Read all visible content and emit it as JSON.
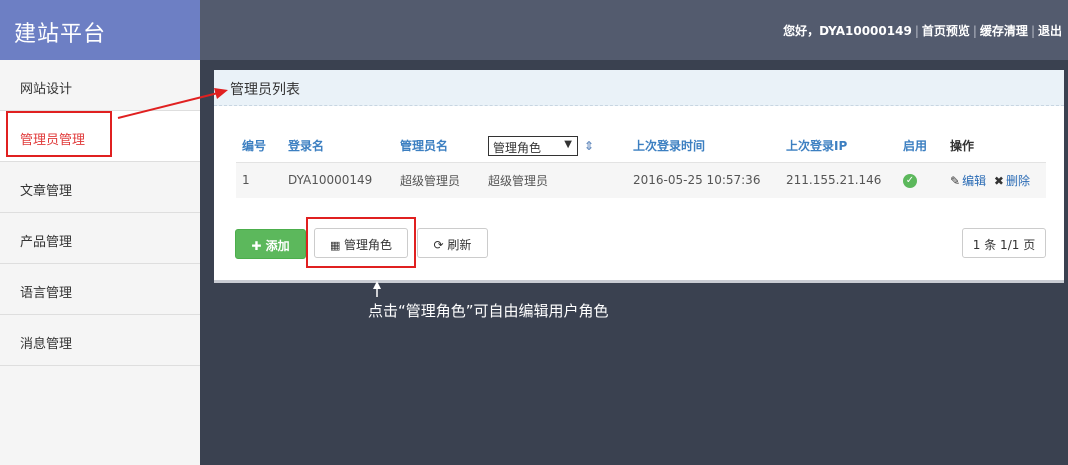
{
  "app": {
    "logo": "建站平台"
  },
  "topnav": {
    "greeting": "您好，",
    "username": "DYA10000149",
    "preview": "首页预览",
    "clear_cache": "缓存清理",
    "logout": "退出"
  },
  "sidebar": {
    "items": [
      {
        "label": "网站设计"
      },
      {
        "label": "管理员管理",
        "active": true
      },
      {
        "label": "文章管理"
      },
      {
        "label": "产品管理"
      },
      {
        "label": "语言管理"
      },
      {
        "label": "消息管理"
      }
    ]
  },
  "panel": {
    "title": "管理员列表",
    "columns": {
      "id": "编号",
      "login": "登录名",
      "admin_name": "管理员名",
      "role_select": "管理角色",
      "last_login_time": "上次登录时间",
      "last_login_ip": "上次登录IP",
      "enabled": "启用",
      "actions": "操作"
    },
    "rows": [
      {
        "id": "1",
        "login": "DYA10000149",
        "admin_name": "超级管理员",
        "role": "超级管理员",
        "last_login_time": "2016-05-25 10:57:36",
        "last_login_ip": "211.155.21.146",
        "edit": "编辑",
        "delete": "删除"
      }
    ],
    "buttons": {
      "add": "添加",
      "manage_roles": "管理角色",
      "refresh": "刷新"
    },
    "pager": "1 条 1/1 页"
  },
  "annotation": "点击“管理角色”可自由编辑用户角色",
  "colors": {
    "logo_bg": "#6d7fc4",
    "topbar_bg": "#535b6e",
    "body_bg": "#3a4150",
    "accent_blue": "#3c7fc1",
    "green": "#5cb85c",
    "annotation_red": "#e02020"
  }
}
